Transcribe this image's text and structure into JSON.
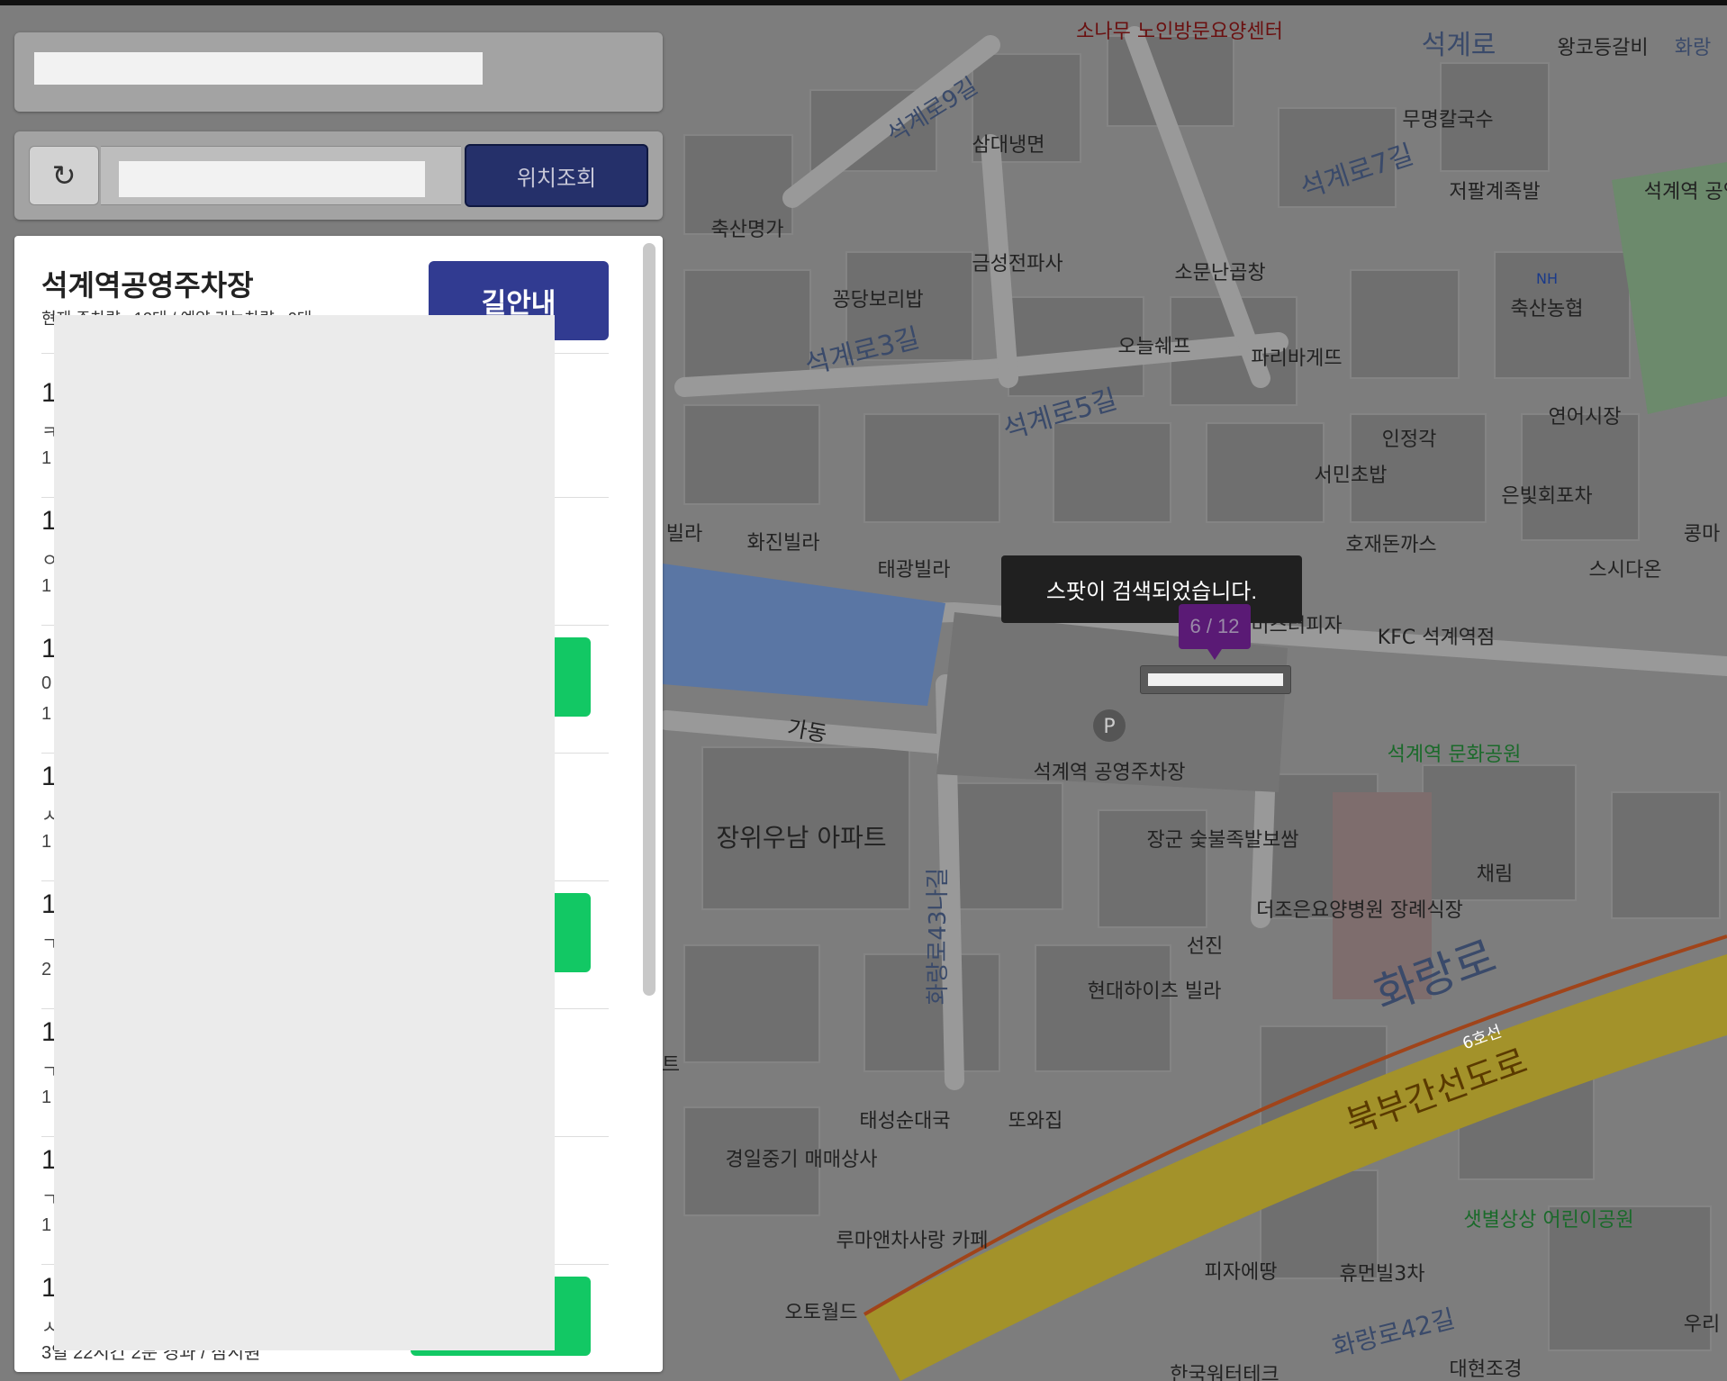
{
  "search": {
    "locate_label": "위치조회",
    "refresh_icon": "refresh-icon"
  },
  "panel": {
    "lot_name": "석계역공영주차장",
    "lot_info": "현재 주차량 : 12대 / 예약 가능차량 : 0대",
    "guide_label": "길안내",
    "rows": [
      {
        "title": "1",
        "sub": "ㅋ",
        "sub2": "1"
      },
      {
        "title": "1",
        "sub": "ㅇ",
        "sub2": "1"
      },
      {
        "title": "1",
        "sub": "0",
        "sub2": "1"
      },
      {
        "title": "1",
        "sub": "ㅅ",
        "sub2": "1"
      },
      {
        "title": "1",
        "sub": "ㄱ",
        "sub2": "2"
      },
      {
        "title": "1",
        "sub": "ㄱ",
        "sub2": "1"
      },
      {
        "title": "1",
        "sub": "ㄱ",
        "sub2": "1"
      },
      {
        "title": "1",
        "sub": "ㅅ",
        "sub2": ""
      }
    ],
    "last_line": "3일 22시간 2분 경과 / 삼시원"
  },
  "toast": "스팟이 검색되었습니다.",
  "marker": {
    "text": "6 / 12"
  },
  "map": {
    "labels": [
      "소나무 노인방문요양센터",
      "왕코등갈비",
      "화랑",
      "석계로",
      "삼대냉면",
      "석계로9길",
      "무명칼국수",
      "저팔계족발",
      "석계역 공영주",
      "축산명가",
      "금성전파사",
      "석계로7길",
      "꽁당보리밥",
      "소문난곱창",
      "석계로3길",
      "NH",
      "축산농협",
      "오늘쉐프",
      "파리바게뜨",
      "석계로5길",
      "연어시장",
      "인정각",
      "서민초밥",
      "은빛회포차",
      "화진빌라",
      "태광빌라",
      "호재돈까스",
      "스시다온",
      "콩마",
      "미스터피자",
      "KFC 석계역점",
      "가동",
      "석계역 공영주차장",
      "석계역 문화공원",
      "장위우남 아파트",
      "장군 숯불족발보쌈",
      "채림",
      "선진",
      "더조은요양병원 장례식장",
      "화랑로43나길",
      "현대하이츠 빌라",
      "화랑로",
      "6호선",
      "북부간선도로",
      "태성순대국",
      "또와집",
      "경일중기 매매상사",
      "루마앤차사랑 카페",
      "피자에땅",
      "휴먼빌3차",
      "샛별상상 어린이공원",
      "오토월드",
      "화랑로42길",
      "대현조경",
      "한국워터테크",
      "우리",
      "빌라",
      "트"
    ],
    "colors": {
      "base": "#7d7d7d",
      "block": "#6f6f6f",
      "road": "#9a9a9a",
      "water": "#5a76a4",
      "park": "#6c8a6c",
      "highway": "#a3922a",
      "rail": "#a0441a"
    }
  }
}
